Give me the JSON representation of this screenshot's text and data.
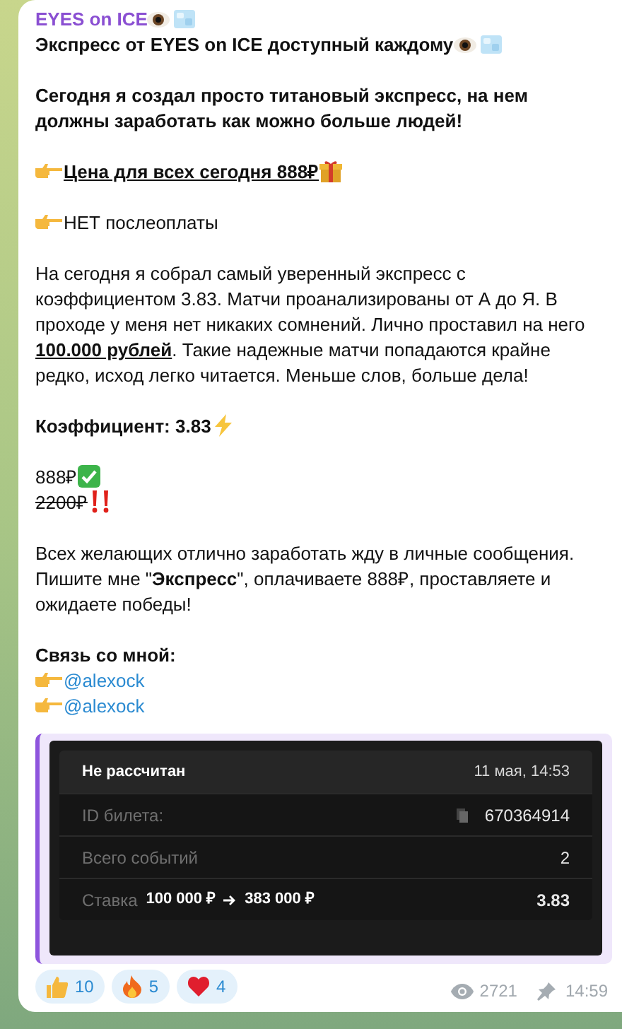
{
  "message": {
    "paragraphs": [
      [
        {
          "kind": "channel",
          "text": "EYES on ICE"
        },
        {
          "kind": "headline",
          "text": "Экспресс от EYES on ICE доступный каждому"
        }
      ],
      [
        {
          "kind": "lead",
          "text": "Сегодня я создал просто титановый экспресс, на нем должны заработать как можно больше людей!"
        }
      ],
      [
        {
          "kind": "price",
          "text": "Цена для всех сегодня 888₽"
        }
      ],
      [
        {
          "kind": "note",
          "text": "НЕТ послеоплаты"
        }
      ],
      [
        {
          "kind": "body",
          "text": "На сегодня я собрал самый уверенный экспресс с коэффициентом 3.83. Матчи проанализированы от А до Я. В проходе у меня нет никаких сомнений. Лично проставил на него **100.000 рублей**. Такие надежные матчи попадаются крайне редко, исход легко читается. Меньше слов, больше дела!"
        }
      ],
      [
        {
          "kind": "coefficient",
          "text": "Коэффициент: 3.83"
        }
      ],
      [
        {
          "kind": "newprice",
          "text": "888₽"
        },
        {
          "kind": "oldprice",
          "text": "2200₽"
        }
      ],
      [
        {
          "kind": "cta",
          "text": "Всех желающих отлично заработать жду в личные сообщения. Пишите мне \"**Экспресс**\", оплачиваете 888₽, проставляете и ожидаете победы!"
        }
      ],
      [
        {
          "kind": "contacts",
          "text": "Связь со мной:"
        },
        {
          "kind": "contact",
          "text": "@alexock"
        },
        {
          "kind": "contact",
          "text": "@alexock"
        }
      ]
    ]
  },
  "ticket": {
    "status": "Не рассчитан",
    "date": "11 мая, 14:53",
    "rows": [
      {
        "kind": "id",
        "label": "ID билета:",
        "value": "670364914"
      },
      {
        "kind": "plain",
        "label": "Всего событий",
        "value": "2"
      },
      {
        "kind": "stake",
        "label": "Ставка",
        "stake": "100 000 ₽",
        "payout": "383 000 ₽",
        "value": "3.83"
      }
    ]
  },
  "reactions": [
    {
      "kind": "thumbs_up",
      "count": "10"
    },
    {
      "kind": "fire",
      "count": "5"
    },
    {
      "kind": "heart",
      "count": "4"
    }
  ],
  "footer": {
    "views": "2721",
    "time": "14:59"
  }
}
